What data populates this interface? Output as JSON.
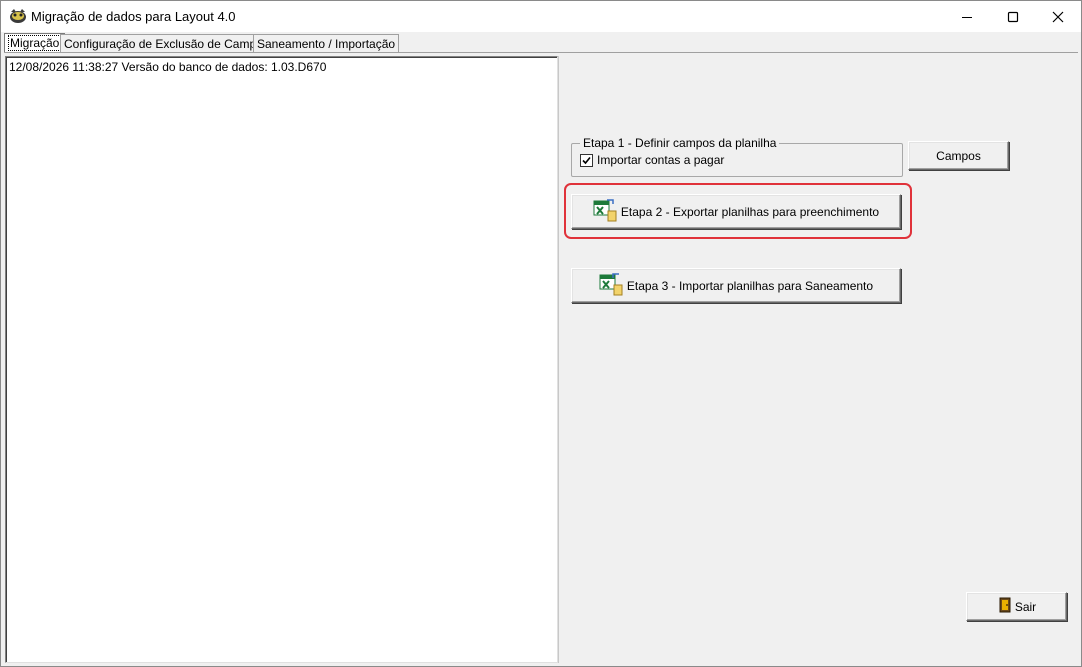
{
  "window": {
    "title": "Migração de dados para Layout 4.0"
  },
  "tabs": [
    {
      "label": "Migração",
      "active": true
    },
    {
      "label": "Configuração de Exclusão de Campos",
      "active": false
    },
    {
      "label": "Saneamento / Importação",
      "active": false
    }
  ],
  "log": {
    "lines": [
      "12/08/2026 11:38:27 Versão do banco de dados: 1.03.D670"
    ]
  },
  "etapa1": {
    "legend": "Etapa 1 - Definir campos da planilha",
    "checkbox_label": "Importar contas a pagar",
    "checked": true,
    "campos_button": "Campos"
  },
  "etapa2": {
    "button_label": "Etapa 2 - Exportar planilhas para preenchimento",
    "icon": "excel-export-icon"
  },
  "etapa3": {
    "button_label": "Etapa 3 - Importar planilhas para Saneamento",
    "icon": "excel-import-icon"
  },
  "sair": {
    "button_label": "Sair",
    "icon": "exit-door-icon"
  },
  "colors": {
    "highlight": "#e0323a",
    "excel_green": "#1d7a3a"
  }
}
